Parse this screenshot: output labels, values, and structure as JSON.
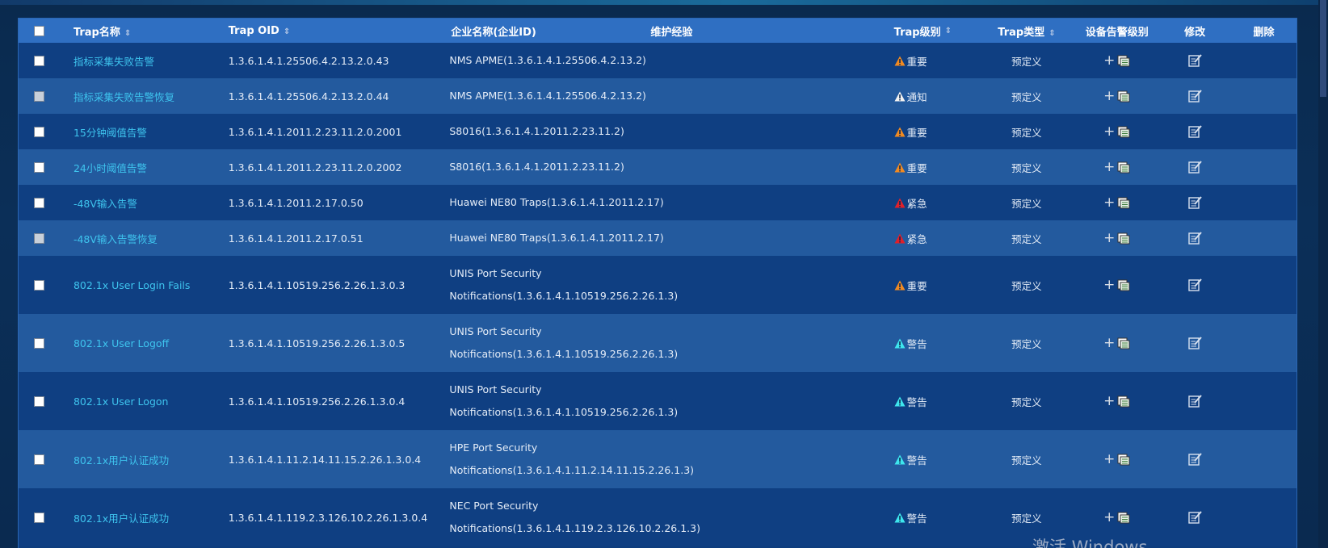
{
  "colors": {
    "header_bg": "#2f6fc2",
    "row_dark": "#0f3f82",
    "row_light": "#235a9e",
    "link": "#3ec4ee",
    "level_major": "#f08a22",
    "level_notice": "#f2f2f2",
    "level_critical": "#e0202a",
    "level_warning": "#3ee6ee"
  },
  "table": {
    "headers": {
      "name": "Trap名称",
      "oid": "Trap OID",
      "vendor": "企业名称(企业ID)",
      "maintenance": "维护经验",
      "level": "Trap级别",
      "type": "Trap类型",
      "device_level": "设备告警级别",
      "edit": "修改",
      "delete": "删除"
    },
    "rows": [
      {
        "name": "指标采集失败告警",
        "oid": "1.3.6.1.4.1.25506.4.2.13.2.0.43",
        "vendor1": "NMS APME(1.3.6.1.4.1.25506.4.2.13.2)",
        "vendor2": "",
        "level": "重要",
        "level_kind": "major",
        "type": "预定义",
        "checkbox_dim": false
      },
      {
        "name": "指标采集失败告警恢复",
        "oid": "1.3.6.1.4.1.25506.4.2.13.2.0.44",
        "vendor1": "NMS APME(1.3.6.1.4.1.25506.4.2.13.2)",
        "vendor2": "",
        "level": "通知",
        "level_kind": "notice",
        "type": "预定义",
        "checkbox_dim": true
      },
      {
        "name": "15分钟阈值告警",
        "oid": "1.3.6.1.4.1.2011.2.23.11.2.0.2001",
        "vendor1": "S8016(1.3.6.1.4.1.2011.2.23.11.2)",
        "vendor2": "",
        "level": "重要",
        "level_kind": "major",
        "type": "预定义",
        "checkbox_dim": false
      },
      {
        "name": "24小时阈值告警",
        "oid": "1.3.6.1.4.1.2011.2.23.11.2.0.2002",
        "vendor1": "S8016(1.3.6.1.4.1.2011.2.23.11.2)",
        "vendor2": "",
        "level": "重要",
        "level_kind": "major",
        "type": "预定义",
        "checkbox_dim": false
      },
      {
        "name": "-48V输入告警",
        "oid": "1.3.6.1.4.1.2011.2.17.0.50",
        "vendor1": "Huawei NE80 Traps(1.3.6.1.4.1.2011.2.17)",
        "vendor2": "",
        "level": "紧急",
        "level_kind": "critical",
        "type": "预定义",
        "checkbox_dim": false
      },
      {
        "name": "-48V输入告警恢复",
        "oid": "1.3.6.1.4.1.2011.2.17.0.51",
        "vendor1": "Huawei NE80 Traps(1.3.6.1.4.1.2011.2.17)",
        "vendor2": "",
        "level": "紧急",
        "level_kind": "critical",
        "type": "预定义",
        "checkbox_dim": true
      },
      {
        "name": "802.1x User Login Fails",
        "oid": "1.3.6.1.4.1.10519.256.2.26.1.3.0.3",
        "vendor1": "UNIS Port Security",
        "vendor2": "Notifications(1.3.6.1.4.1.10519.256.2.26.1.3)",
        "level": "重要",
        "level_kind": "major",
        "type": "预定义",
        "checkbox_dim": false
      },
      {
        "name": "802.1x User Logoff",
        "oid": "1.3.6.1.4.1.10519.256.2.26.1.3.0.5",
        "vendor1": "UNIS Port Security",
        "vendor2": "Notifications(1.3.6.1.4.1.10519.256.2.26.1.3)",
        "level": "警告",
        "level_kind": "warning",
        "type": "预定义",
        "checkbox_dim": false
      },
      {
        "name": "802.1x User Logon",
        "oid": "1.3.6.1.4.1.10519.256.2.26.1.3.0.4",
        "vendor1": "UNIS Port Security",
        "vendor2": "Notifications(1.3.6.1.4.1.10519.256.2.26.1.3)",
        "level": "警告",
        "level_kind": "warning",
        "type": "预定义",
        "checkbox_dim": false
      },
      {
        "name": "802.1x用户认证成功",
        "oid": "1.3.6.1.4.1.11.2.14.11.15.2.26.1.3.0.4",
        "vendor1": "HPE Port Security",
        "vendor2": "Notifications(1.3.6.1.4.1.11.2.14.11.15.2.26.1.3)",
        "level": "警告",
        "level_kind": "warning",
        "type": "预定义",
        "checkbox_dim": false
      },
      {
        "name": "802.1x用户认证成功",
        "oid": "1.3.6.1.4.1.119.2.3.126.10.2.26.1.3.0.4",
        "vendor1": "NEC Port Security",
        "vendor2": "Notifications(1.3.6.1.4.1.119.2.3.126.10.2.26.1.3)",
        "level": "警告",
        "level_kind": "warning",
        "type": "预定义",
        "checkbox_dim": false
      }
    ]
  },
  "watermark": "激活 Windows"
}
